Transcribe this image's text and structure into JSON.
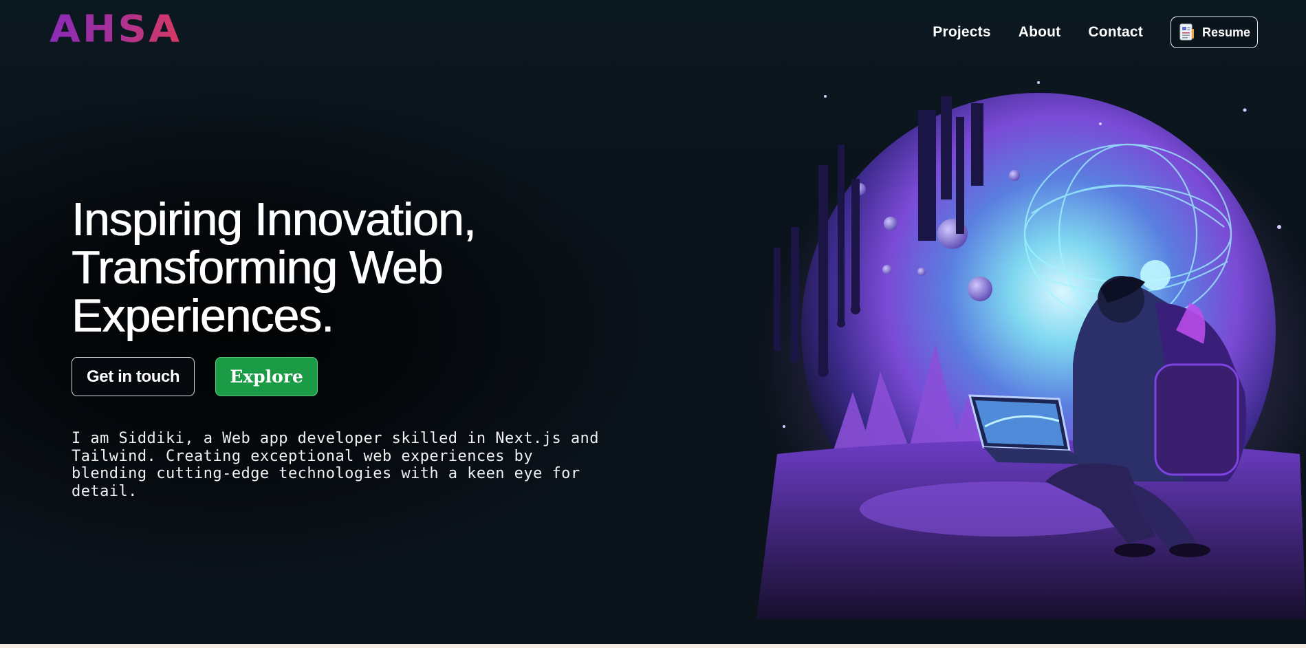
{
  "brand": {
    "logo_text": "AHSA"
  },
  "nav": {
    "items": [
      {
        "label": "Projects"
      },
      {
        "label": "About"
      },
      {
        "label": "Contact"
      }
    ],
    "resume_label": "Resume"
  },
  "hero": {
    "title_lines": [
      "Inspiring Innovation,",
      "Transforming Web",
      "Experiences."
    ],
    "get_in_touch_label": "Get in touch",
    "explore_label": "Explore",
    "description": "I am Siddiki, a Web app developer skilled in Next.js and Tailwind. Creating exceptional web experiences by blending cutting-edge technologies with a keen eye for detail."
  },
  "colors": {
    "background": "#0b141d",
    "logo_gradient_start": "#8b2bb7",
    "logo_gradient_end": "#d83a63",
    "explore_green": "#1c9b47",
    "bottom_strip": "#f3ebe1"
  },
  "icons": {
    "resume": "document-icon",
    "hero_image": "astronaut-coder-illustration"
  }
}
